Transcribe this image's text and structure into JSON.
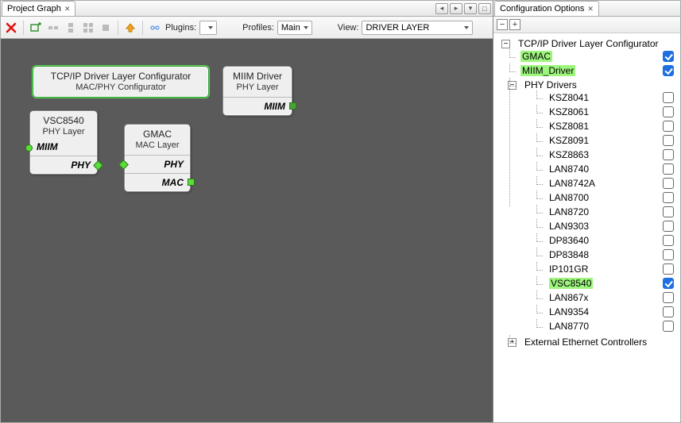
{
  "left": {
    "tab_title": "Project Graph",
    "toolbar": {
      "plugins_label": "Plugins:",
      "plugins_value": "",
      "profiles_label": "Profiles:",
      "profiles_value": "Main",
      "view_label": "View:",
      "view_value": "DRIVER LAYER"
    },
    "nodes": {
      "configurator": {
        "title": "TCP/IP Driver Layer Configurator",
        "sub": "MAC/PHY Configurator"
      },
      "miim": {
        "title": "MIIM Driver",
        "sub": "PHY Layer",
        "row1": "MIIM"
      },
      "vsc": {
        "title": "VSC8540",
        "sub": "PHY Layer",
        "row1": "MIIM",
        "row2": "PHY"
      },
      "gmac": {
        "title": "GMAC",
        "sub": "MAC Layer",
        "row1": "PHY",
        "row2": "MAC"
      }
    }
  },
  "right": {
    "tab_title": "Configuration Options",
    "tree": {
      "root_label": "TCP/IP Driver Layer Configurator",
      "gmac_label": "GMAC",
      "miim_label": "MIIM_Driver",
      "phy_label": "PHY Drivers",
      "ext_label": "External Ethernet Controllers",
      "phy_items": [
        {
          "label": "KSZ8041",
          "checked": false
        },
        {
          "label": "KSZ8061",
          "checked": false
        },
        {
          "label": "KSZ8081",
          "checked": false
        },
        {
          "label": "KSZ8091",
          "checked": false
        },
        {
          "label": "KSZ8863",
          "checked": false
        },
        {
          "label": "LAN8740",
          "checked": false
        },
        {
          "label": "LAN8742A",
          "checked": false
        },
        {
          "label": "LAN8700",
          "checked": false
        },
        {
          "label": "LAN8720",
          "checked": false
        },
        {
          "label": "LAN9303",
          "checked": false
        },
        {
          "label": "DP83640",
          "checked": false
        },
        {
          "label": "DP83848",
          "checked": false
        },
        {
          "label": "IP101GR",
          "checked": false
        },
        {
          "label": "VSC8540",
          "checked": true
        },
        {
          "label": "LAN867x",
          "checked": false
        },
        {
          "label": "LAN9354",
          "checked": false
        },
        {
          "label": "LAN8770",
          "checked": false
        }
      ]
    }
  }
}
